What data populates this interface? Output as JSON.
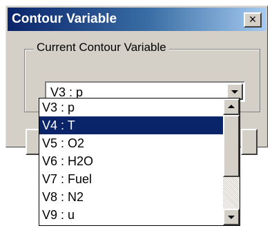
{
  "window": {
    "title": "Contour Variable",
    "close_label": "×"
  },
  "group": {
    "label": "Current Contour Variable"
  },
  "combo": {
    "value": "V3 : p"
  },
  "dropdown": {
    "items": [
      {
        "label": "V3 : p",
        "selected": false
      },
      {
        "label": "V4 : T",
        "selected": true
      },
      {
        "label": "V5 : O2",
        "selected": false
      },
      {
        "label": "V6 : H2O",
        "selected": false
      },
      {
        "label": "V7 : Fuel",
        "selected": false
      },
      {
        "label": "V8 : N2",
        "selected": false
      },
      {
        "label": "V9 : u",
        "selected": false
      }
    ]
  },
  "icons": {
    "close": "close-icon",
    "combo_arrow": "chevron-down-icon",
    "scroll_up": "scroll-up-icon",
    "scroll_down": "scroll-down-icon"
  },
  "colors": {
    "titlebar_start": "#0a246a",
    "titlebar_end": "#a6caf0",
    "selection": "#0a246a",
    "face": "#d4d0c8"
  }
}
